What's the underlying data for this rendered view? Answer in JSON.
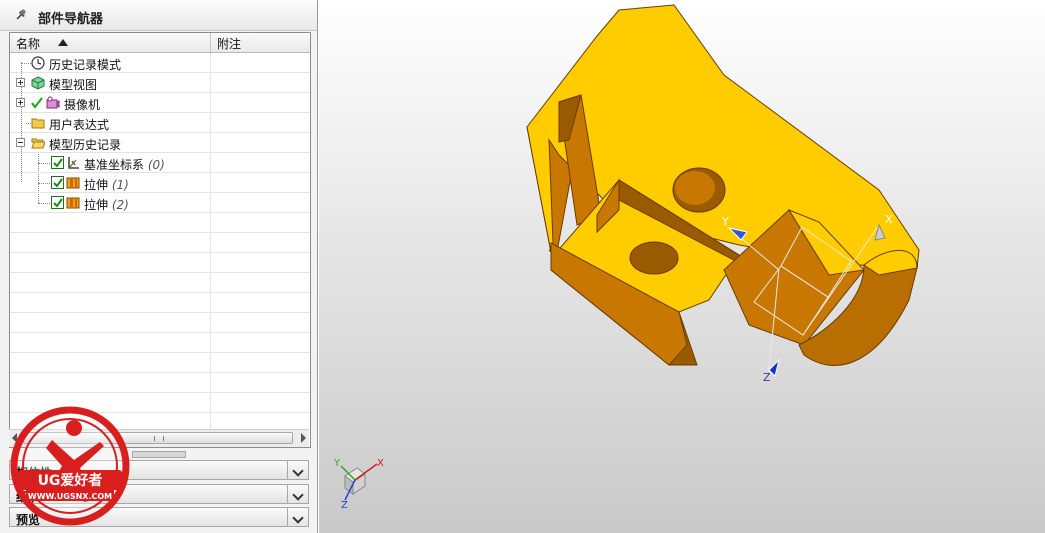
{
  "navigator": {
    "title": "部件导航器",
    "columns": {
      "name": "名称",
      "note": "附注"
    },
    "items": [
      {
        "label": "历史记录模式",
        "num": ""
      },
      {
        "label": "模型视图",
        "num": ""
      },
      {
        "label": "摄像机",
        "num": ""
      },
      {
        "label": "用户表达式",
        "num": ""
      },
      {
        "label": "模型历史记录",
        "num": ""
      },
      {
        "label": "基准坐标系",
        "num": "(0)"
      },
      {
        "label": "拉伸",
        "num": "(1)"
      },
      {
        "label": "拉伸",
        "num": "(2)"
      }
    ],
    "sections": [
      {
        "label": "相依性"
      },
      {
        "label": "细节"
      },
      {
        "label": "预览"
      }
    ]
  },
  "viewport": {
    "csys_axes": {
      "x": "X",
      "y": "Y",
      "z": "Z"
    },
    "triad_axes": {
      "x": "X",
      "y": "Y",
      "z": "Z"
    }
  },
  "watermark": {
    "brand": "UG爱好者",
    "url": "WWW.UGSNX.COM"
  },
  "colors": {
    "part": "#FFCC00",
    "part_side": "#CC7A00",
    "part_dark": "#9A5A00",
    "accent": "#D91E1E"
  }
}
